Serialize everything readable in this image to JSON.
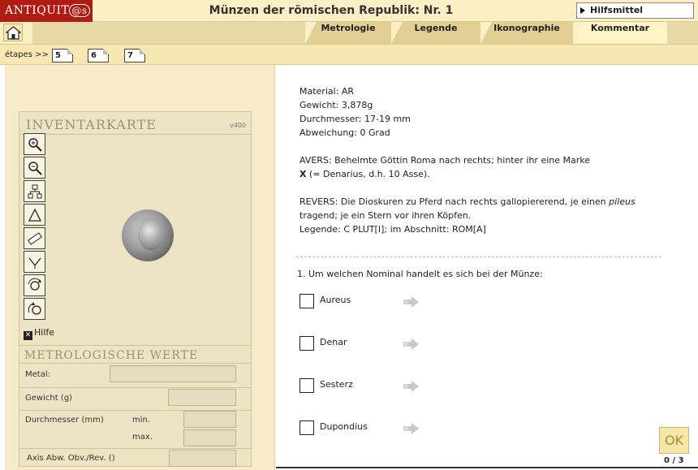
{
  "header": {
    "logo_text": "ANTIQUIT",
    "logo_at": "@s",
    "title": "Münzen der römischen Republik: Nr. 1",
    "hilfsmittel": "Hilfsmittel"
  },
  "tabs": [
    {
      "label": "Metrologie"
    },
    {
      "label": "Legende"
    },
    {
      "label": "Ikonographie"
    },
    {
      "label": "Kommentar"
    }
  ],
  "steps": {
    "label": "étapes >>",
    "items": [
      "5",
      "6",
      "7"
    ]
  },
  "card": {
    "title": "INVENTARKARTE",
    "version": "v400",
    "tools": [
      "zoom-in-icon",
      "zoom-out-icon",
      "hierarchy-icon",
      "triangle-icon",
      "ruler-icon",
      "scale-icon",
      "rotate-icon",
      "flip-icon"
    ],
    "hilfe_label": "Hilfe",
    "metrology_title": "METROLOGISCHE WERTE",
    "metal_label": "Metal:",
    "weight_label": "Gewicht (g)",
    "diameter_label": "Durchmesser (mm)",
    "min_label": "min.",
    "max_label": "max.",
    "axis_label": "Axis Abw. Obv./Rev. ()"
  },
  "description": {
    "material": "Material: AR",
    "weight": "Gewicht: 3,878g",
    "diameter": "Durchmesser: 17-19 mm",
    "deviation": "Abweichung: 0 Grad",
    "avers_line1": "AVERS: Behelmte Göttin Roma nach rechts; hinter ihr eine Marke",
    "avers_x": "X",
    "avers_line2": " (= Denarius, d.h. 10 Asse).",
    "revers_line1_pre": "REVERS: Die Dioskuren zu Pferd nach rechts gallopiererend, je einen ",
    "revers_pileus": "pileus",
    "revers_line2": "tragend; je ein Stern vor ihren Köpfen.",
    "revers_line3": "Legende: C PLUT[I];  im Abschnitt: ROM[A]"
  },
  "question": {
    "text": "1. Um welchen Nominal handelt es sich bei der Münze:",
    "options": [
      "Aureus",
      "Denar",
      "Sesterz",
      "Dupondius"
    ]
  },
  "footer": {
    "ok_label": "OK",
    "page_count": "0 / 3"
  },
  "colors": {
    "logo_bg": "#b01c14",
    "header_bg": "#fbefc5",
    "tab_bg": "#e1cf93",
    "panel_bg": "#f6eacb",
    "ok_bg": "#f6e7a8"
  }
}
